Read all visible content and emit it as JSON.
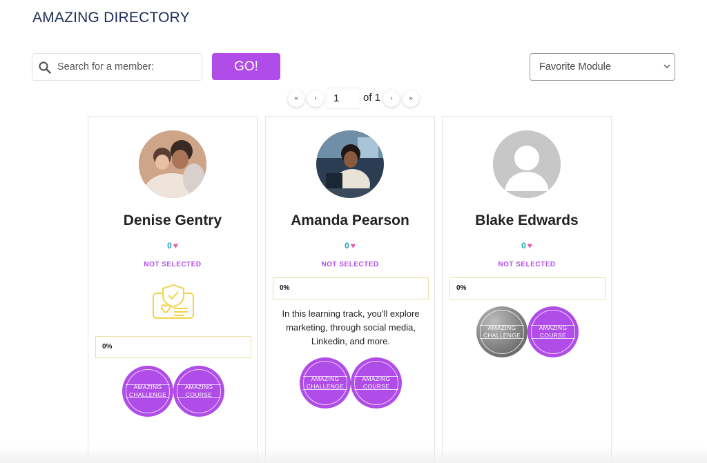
{
  "header": {
    "title": "AMAZING DIRECTORY"
  },
  "search": {
    "placeholder": "Search for a member:",
    "value": "",
    "button_label": "GO!"
  },
  "module_select": {
    "selected": "Favorite Module"
  },
  "pagination": {
    "first": "«",
    "prev": "‹",
    "current_page": "1",
    "of_label": "of 1",
    "next": "›",
    "last": "»"
  },
  "members": [
    {
      "name": "Denise Gentry",
      "likes": "0",
      "status": "NOT SELECTED",
      "progress": "0%",
      "badges": [
        {
          "label": "AMAZING\nCHALLENGE",
          "color": "#b04ce8"
        },
        {
          "label": "AMAZING\nCOURSE",
          "color": "#b04ce8"
        }
      ]
    },
    {
      "name": "Amanda Pearson",
      "likes": "0",
      "status": "NOT SELECTED",
      "progress": "0%",
      "description": "In this learning track, you'll explore marketing, through social media, Linkedin, and more.",
      "badges": [
        {
          "label": "AMAZING\nCHALLENGE",
          "color": "#b04ce8"
        },
        {
          "label": "AMAZING\nCOURSE",
          "color": "#b04ce8"
        }
      ]
    },
    {
      "name": "Blake Edwards",
      "likes": "0",
      "status": "NOT SELECTED",
      "progress": "0%",
      "badges": [
        {
          "label": "AMAZING\nCHALLENGE",
          "color": "#7a7a7a"
        },
        {
          "label": "AMAZING\nCOURSE",
          "color": "#b04ce8"
        }
      ]
    }
  ],
  "colors": {
    "accent": "#b04ce8",
    "title": "#1f2a56",
    "likes": "#1fa3b8",
    "heart": "#e75aa8",
    "module_icon": "#f2d34a"
  }
}
